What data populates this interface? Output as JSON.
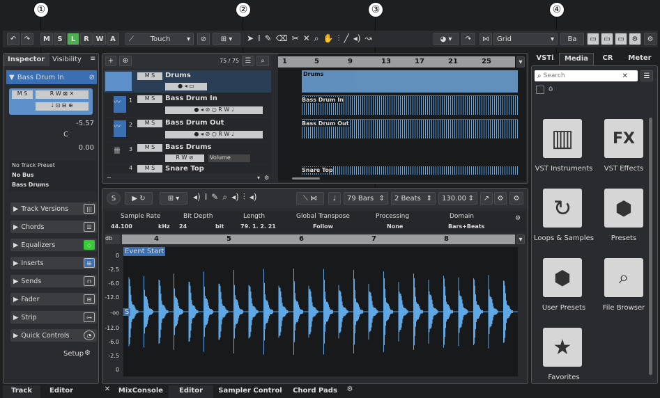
{
  "callouts": [
    "①",
    "②",
    "③",
    "④"
  ],
  "toolbar": {
    "m": "M",
    "s": "S",
    "l": "L",
    "r": "R",
    "w": "W",
    "a": "A",
    "automation_mode": "Touch",
    "snap_type": "Grid",
    "bars_label": "Ba"
  },
  "inspector": {
    "tab_inspector": "Inspector",
    "tab_visibility": "Visibility",
    "track_name": "Bass Drum In",
    "volume": "-5.57",
    "pan": "C",
    "delay": "0.00",
    "preset": "No Track Preset",
    "input": "No Bus",
    "output": "Bass Drums",
    "setup": "Setup",
    "sections": [
      "Track Versions",
      "Chords",
      "Equalizers",
      "Inserts",
      "Sends",
      "Fader",
      "Strip",
      "Quick Controls"
    ]
  },
  "tracklist": {
    "count": "75 / 75",
    "tracks": [
      {
        "num": "",
        "name": "Drums"
      },
      {
        "num": "1",
        "name": "Bass Drum In"
      },
      {
        "num": "2",
        "name": "Bass Drum Out"
      },
      {
        "num": "3",
        "name": "Bass Drums",
        "volume": "Volume"
      },
      {
        "num": "4",
        "name": "Snare Top"
      }
    ]
  },
  "ruler": {
    "marks": [
      "1",
      "5",
      "9",
      "13",
      "17",
      "21",
      "25"
    ]
  },
  "events": [
    "Drums",
    "Bass Drum In",
    "Bass Drum Out",
    "Snare Top"
  ],
  "editor": {
    "length": "79 Bars",
    "beats": "2 Beats",
    "tempo": "130.00",
    "info_headers": [
      "Sample Rate",
      "Bit Depth",
      "Length",
      "Global Transpose",
      "Processing",
      "Domain"
    ],
    "info_values": [
      "44.100",
      "kHz",
      "24",
      "bit",
      "79. 1. 2. 21",
      "Follow",
      "None",
      "Bars+Beats"
    ],
    "ruler": [
      "4",
      "5",
      "6",
      "7",
      "8"
    ],
    "db_label": "db",
    "event_start": "Event Start",
    "db_scale": [
      "0",
      "-2.5",
      "-6.0",
      "-12.0",
      "-oo",
      "-12.0",
      "-6.0",
      "-2.5",
      "0"
    ],
    "s_marker": "S"
  },
  "right_zone": {
    "tabs": [
      "VSTi",
      "Media",
      "CR",
      "Meter"
    ],
    "search_placeholder": "Search",
    "tiles": [
      {
        "label": "VST Instruments"
      },
      {
        "label": "VST Effects",
        "glyph": "FX"
      },
      {
        "label": "Loops & Samples"
      },
      {
        "label": "Presets"
      },
      {
        "label": "User Presets"
      },
      {
        "label": "File Browser"
      },
      {
        "label": "Favorites"
      }
    ]
  },
  "bottom_tabs": {
    "left": [
      "Track",
      "Editor"
    ],
    "lower": [
      "MixConsole",
      "Editor",
      "Sampler Control",
      "Chord Pads"
    ]
  }
}
